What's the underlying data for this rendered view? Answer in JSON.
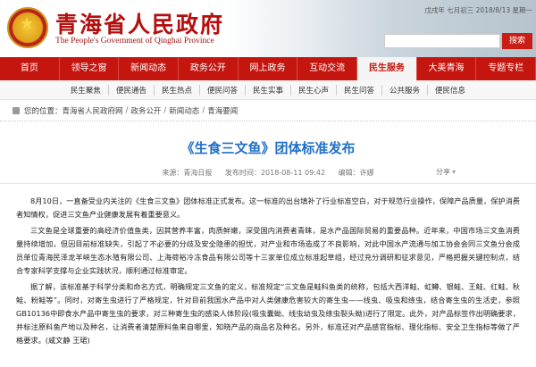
{
  "header": {
    "title": "青海省人民政府",
    "subtitle": "The People's Government of Qinghai Province",
    "date": "戊戌年 七月初三 2018/8/13 星期一",
    "search_button": "搜索"
  },
  "nav": {
    "items": [
      "首页",
      "领导之窗",
      "新闻动态",
      "政务公开",
      "网上政务",
      "互动交流",
      "民生服务",
      "大美青海",
      "专题专栏"
    ]
  },
  "subnav": {
    "items": [
      "民生聚焦",
      "便民通告",
      "民生热点",
      "便民问答",
      "民生实事",
      "民生心声",
      "民生问答",
      "公共服务",
      "便民信息"
    ]
  },
  "breadcrumb": {
    "prefix": "您的位置：",
    "items": [
      "青海省人民政府网",
      "政务公开",
      "新闻动态",
      "青海要闻"
    ]
  },
  "article": {
    "title": "《生食三文鱼》团体标准发布",
    "meta": {
      "source": "来源：青海日报",
      "time": "发布时间：2018-08-11 09:42",
      "editor": "编辑：许娜",
      "share": "分享"
    },
    "paragraphs": [
      "8月10日，一直备受业内关注的《生食三文鱼》团体标准正式发布。这一标准的出台填补了行业标准空白，对于规范行业操作，保障产品质量，保护消费者知情权，促进三文鱼产业健康发展有着重要意义。",
      "三文鱼是全球重要的高经济价值鱼类，因其营养丰富，肉质鲜嫩，深受国内消费者青睐，是水产品国际贸易的重要品种。近年来，中国市场三文鱼消费量持续增加，但因目前标准缺失，引起了不必要的分歧及安全隐患的担忧，对产业和市场造成了不良影响，对此中国水产流通与加工协会会同三文鱼分会成员单位青海民泽龙羊峡生态水殖有限公司、上海荷裕冷冻食品有限公司等十三家单位成立标准起草组，经过充分调研和征求意见，严格把握关键控制点，结合专家科学支撑与企业实践状况，顺利通过标准审定。",
      "据了解，该标准基于科学分类和命名方式，明确规定三文鱼的定义，标准规定“三文鱼是鲑科鱼类的统称，包括大西洋鲑、虹鳟、银鲑、王鲑、红鲑、秋鲑、粉鲑等”。同时，对寄生虫进行了严格规定，针对目前我国水产品中对人类健康危害较大的寄生虫——线虫、吸虫和绦虫，结合寄生虫的生活史，参照GB10136中即食水产品中寄生虫的要求，对三种寄生虫的感染人体阶段(吸虫囊蚴、线虫幼虫及绦虫裂头蚴)进行了限定。此外，对产品标签作出明确要求，并标注原料鱼产地以及种名，让消费者清楚原料鱼来自哪里，知晓产品的商品名及种名。另外，标准还对产品感官指标、理化指标、安全卫生指标等做了严格要求。(咸文静 王珺)"
    ]
  }
}
